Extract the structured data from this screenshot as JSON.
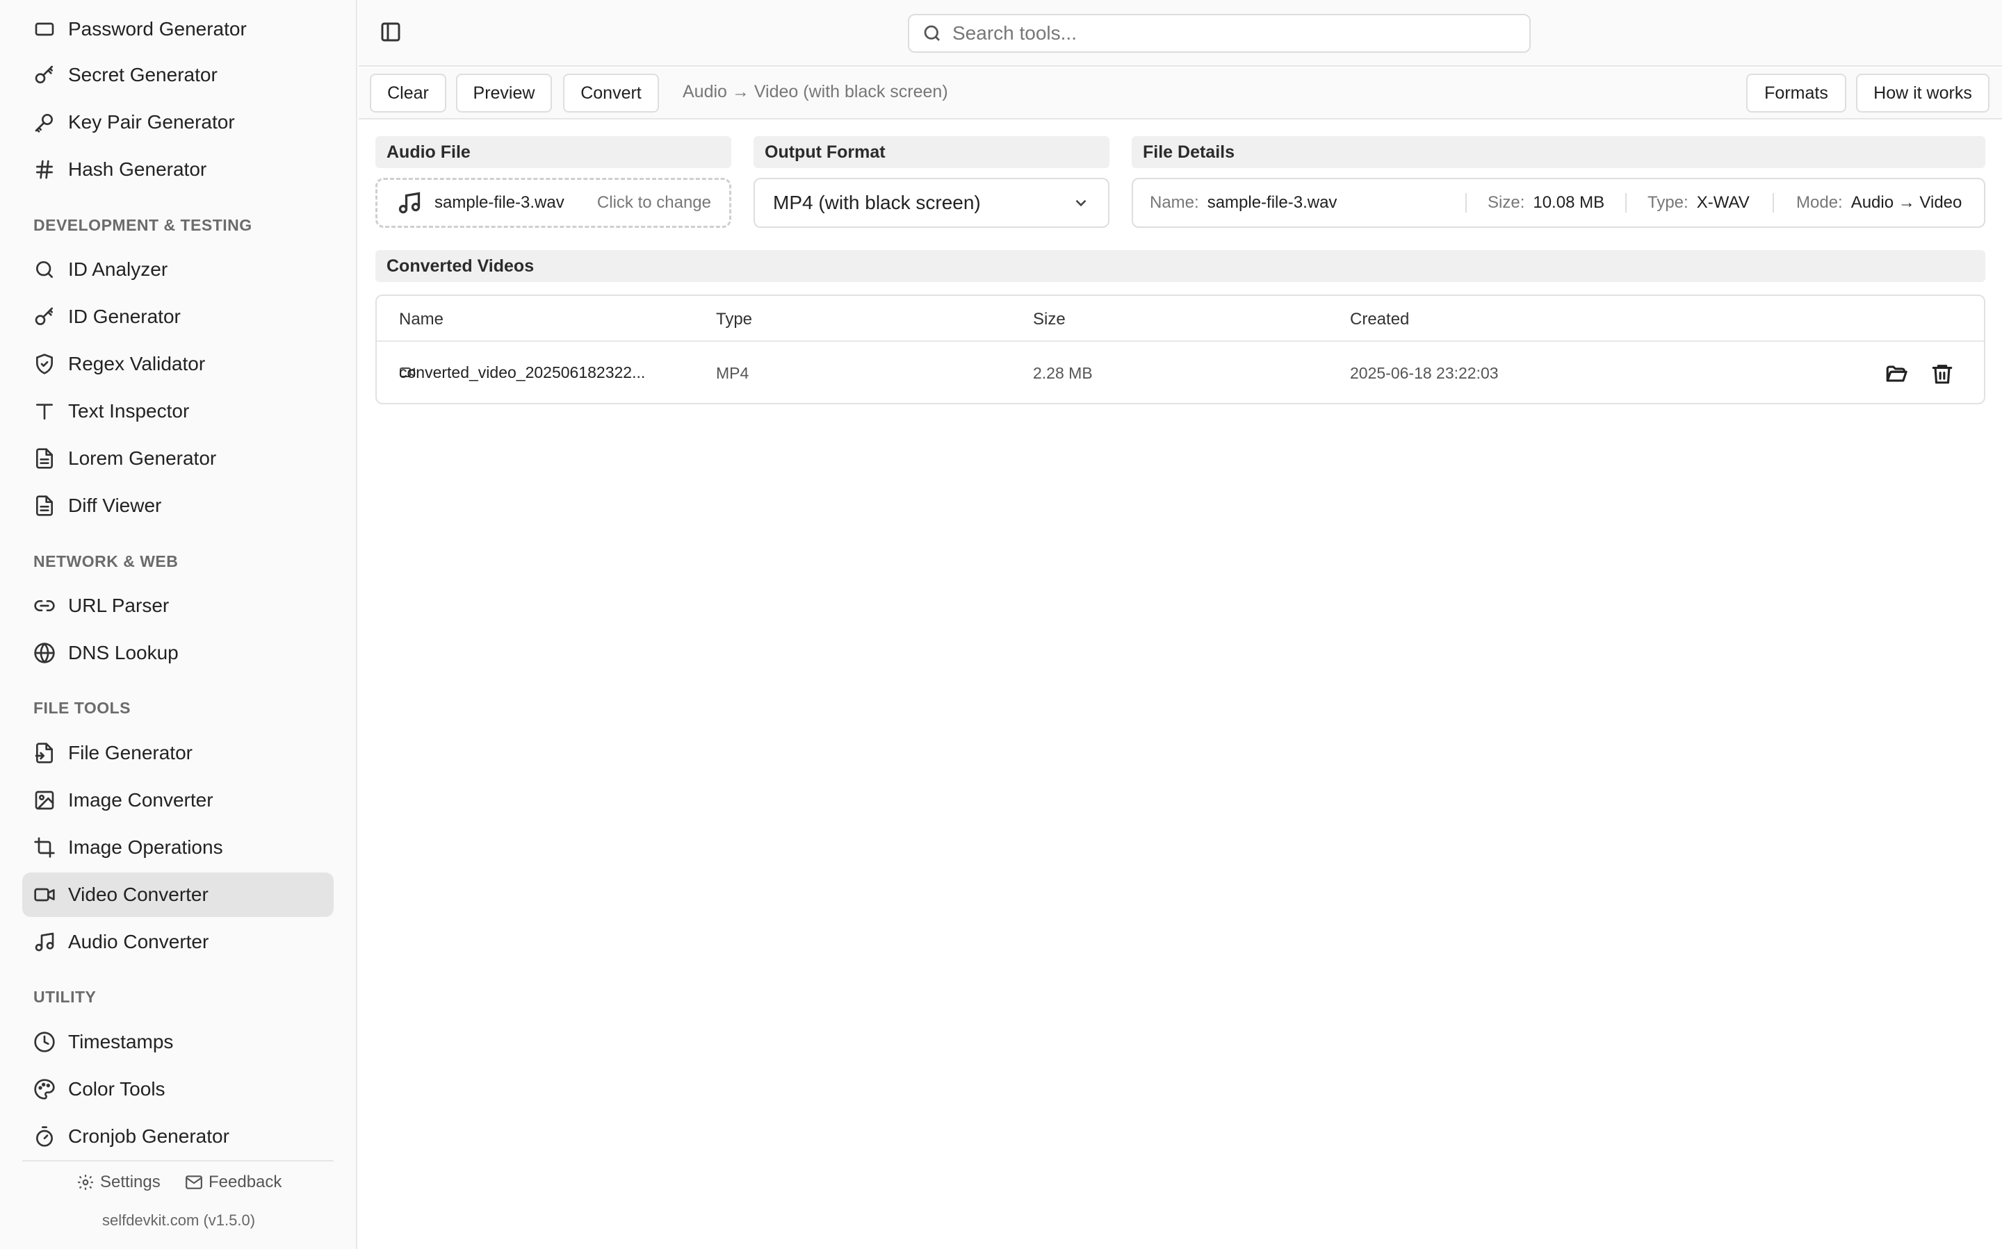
{
  "sidebar": {
    "partial_item": "Password Generator",
    "items_top": [
      {
        "label": "Secret Generator",
        "icon": "key-icon"
      },
      {
        "label": "Key Pair Generator",
        "icon": "key-pair-icon"
      },
      {
        "label": "Hash Generator",
        "icon": "hash-icon"
      }
    ],
    "sections": [
      {
        "heading": "DEVELOPMENT & TESTING",
        "items": [
          {
            "label": "ID Analyzer",
            "icon": "search-icon"
          },
          {
            "label": "ID Generator",
            "icon": "key-icon"
          },
          {
            "label": "Regex Validator",
            "icon": "shield-check-icon"
          },
          {
            "label": "Text Inspector",
            "icon": "text-icon"
          },
          {
            "label": "Lorem Generator",
            "icon": "document-icon"
          },
          {
            "label": "Diff Viewer",
            "icon": "document-icon"
          }
        ]
      },
      {
        "heading": "NETWORK & WEB",
        "items": [
          {
            "label": "URL Parser",
            "icon": "link-icon"
          },
          {
            "label": "DNS Lookup",
            "icon": "globe-icon"
          }
        ]
      },
      {
        "heading": "FILE TOOLS",
        "items": [
          {
            "label": "File Generator",
            "icon": "file-plus-icon"
          },
          {
            "label": "Image Converter",
            "icon": "image-icon"
          },
          {
            "label": "Image Operations",
            "icon": "crop-icon"
          },
          {
            "label": "Video Converter",
            "icon": "video-icon"
          },
          {
            "label": "Audio Converter",
            "icon": "music-icon"
          }
        ]
      },
      {
        "heading": "UTILITY",
        "items": [
          {
            "label": "Timestamps",
            "icon": "clock-icon"
          },
          {
            "label": "Color Tools",
            "icon": "palette-icon"
          },
          {
            "label": "Cronjob Generator",
            "icon": "timer-icon"
          }
        ]
      }
    ],
    "active_item": "Video Converter",
    "footer": {
      "settings": "Settings",
      "feedback": "Feedback",
      "version": "selfdevkit.com (v1.5.0)"
    }
  },
  "search": {
    "placeholder": "Search tools..."
  },
  "toolbar": {
    "clear": "Clear",
    "preview": "Preview",
    "convert": "Convert",
    "status": "Audio → Video (with black screen)",
    "formats": "Formats",
    "how_it_works": "How it works"
  },
  "audio_file": {
    "heading": "Audio File",
    "file_name": "sample-file-3.wav",
    "hint": "Click to change"
  },
  "output_format": {
    "heading": "Output Format",
    "selected": "MP4 (with black screen)"
  },
  "file_details": {
    "heading": "File Details",
    "name_label": "Name:",
    "name_value": "sample-file-3.wav",
    "size_label": "Size:",
    "size_value": "10.08 MB",
    "type_label": "Type:",
    "type_value": "X-WAV",
    "mode_label": "Mode:",
    "mode_value": "Audio → Video"
  },
  "converted": {
    "heading": "Converted Videos",
    "columns": [
      "Name",
      "Type",
      "Size",
      "Created"
    ],
    "rows": [
      {
        "name": "converted_video_202506182322...",
        "type": "MP4",
        "size": "2.28 MB",
        "created": "2025-06-18 23:22:03"
      }
    ]
  },
  "colors": {
    "active_bg": "#e4e4e4",
    "border": "#dedede",
    "muted_text": "#777777"
  }
}
